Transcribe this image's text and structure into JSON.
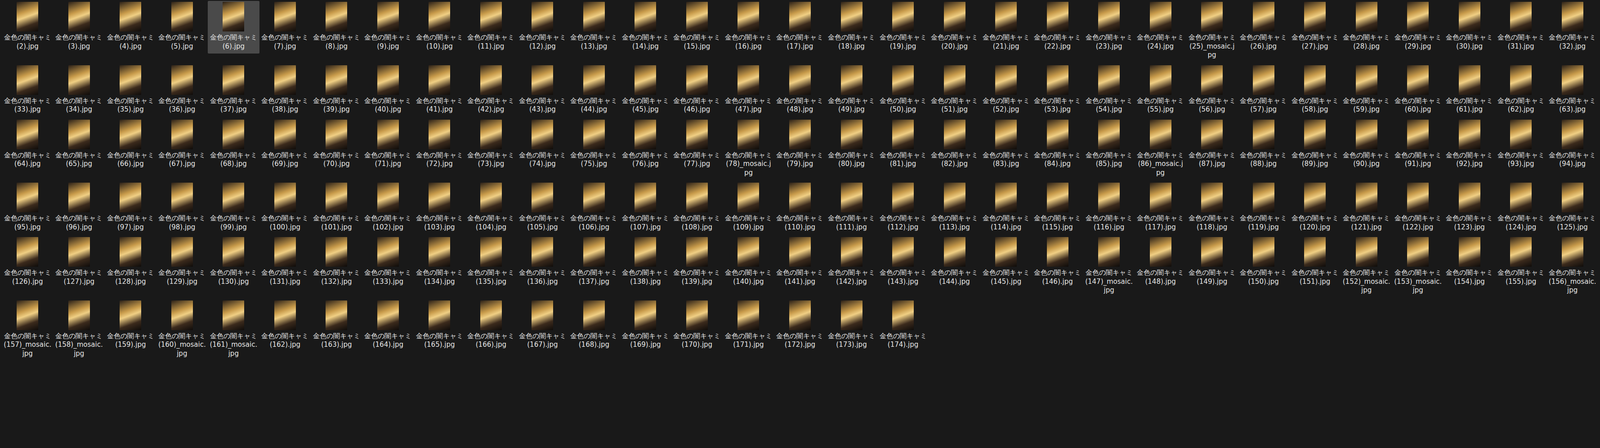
{
  "items": [
    {
      "label": "金色の闇キャミ (2).jpg",
      "selected": false
    },
    {
      "label": "金色の闇キャミ (3).jpg",
      "selected": false
    },
    {
      "label": "金色の闇キャミ (4).jpg",
      "selected": false
    },
    {
      "label": "金色の闇キャミ (5).jpg",
      "selected": false
    },
    {
      "label": "金色の闇キャミ (6).jpg",
      "selected": true
    },
    {
      "label": "金色の闇キャミ (7).jpg",
      "selected": false
    },
    {
      "label": "金色の闇キャミ (8).jpg",
      "selected": false
    },
    {
      "label": "金色の闇キャミ (9).jpg",
      "selected": false
    },
    {
      "label": "金色の闇キャミ (10).jpg",
      "selected": false
    },
    {
      "label": "金色の闇キャミ (11).jpg",
      "selected": false
    },
    {
      "label": "金色の闇キャミ (12).jpg",
      "selected": false
    },
    {
      "label": "金色の闇キャミ (13).jpg",
      "selected": false
    },
    {
      "label": "金色の闇キャミ (14).jpg",
      "selected": false
    },
    {
      "label": "金色の闇キャミ (15).jpg",
      "selected": false
    },
    {
      "label": "金色の闇キャミ (16).jpg",
      "selected": false
    },
    {
      "label": "金色の闇キャミ (17).jpg",
      "selected": false
    },
    {
      "label": "金色の闇キャミ (18).jpg",
      "selected": false
    },
    {
      "label": "金色の闇キャミ (19).jpg",
      "selected": false
    },
    {
      "label": "金色の闇キャミ (20).jpg",
      "selected": false
    },
    {
      "label": "金色の闇キャミ (21).jpg",
      "selected": false
    },
    {
      "label": "金色の闇キャミ (22).jpg",
      "selected": false
    },
    {
      "label": "金色の闇キャミ (23).jpg",
      "selected": false
    },
    {
      "label": "金色の闇キャミ (24).jpg",
      "selected": false
    },
    {
      "label": "金色の闇キャミ (25)_mosaic.jpg",
      "selected": false
    },
    {
      "label": "金色の闇キャミ (26).jpg",
      "selected": false
    },
    {
      "label": "金色の闇キャミ (27).jpg",
      "selected": false
    },
    {
      "label": "金色の闇キャミ (28).jpg",
      "selected": false
    },
    {
      "label": "金色の闇キャミ (29).jpg",
      "selected": false
    },
    {
      "label": "金色の闇キャミ (30).jpg",
      "selected": false
    },
    {
      "label": "金色の闇キャミ (31).jpg",
      "selected": false
    },
    {
      "label": "金色の闇キャミ (32).jpg",
      "selected": false
    },
    {
      "label": "金色の闇キャミ (33).jpg",
      "selected": false
    },
    {
      "label": "金色の闇キャミ (34).jpg",
      "selected": false
    },
    {
      "label": "金色の闇キャミ (35).jpg",
      "selected": false
    },
    {
      "label": "金色の闇キャミ (36).jpg",
      "selected": false
    },
    {
      "label": "金色の闇キャミ (37).jpg",
      "selected": false
    },
    {
      "label": "金色の闇キャミ (38).jpg",
      "selected": false
    },
    {
      "label": "金色の闇キャミ (39).jpg",
      "selected": false
    },
    {
      "label": "金色の闇キャミ (40).jpg",
      "selected": false
    },
    {
      "label": "金色の闇キャミ (41).jpg",
      "selected": false
    },
    {
      "label": "金色の闇キャミ (42).jpg",
      "selected": false
    },
    {
      "label": "金色の闇キャミ (43).jpg",
      "selected": false
    },
    {
      "label": "金色の闇キャミ (44).jpg",
      "selected": false
    },
    {
      "label": "金色の闇キャミ (45).jpg",
      "selected": false
    },
    {
      "label": "金色の闇キャミ (46).jpg",
      "selected": false
    },
    {
      "label": "金色の闇キャミ (47).jpg",
      "selected": false
    },
    {
      "label": "金色の闇キャミ (48).jpg",
      "selected": false
    },
    {
      "label": "金色の闇キャミ (49).jpg",
      "selected": false
    },
    {
      "label": "金色の闇キャミ (50).jpg",
      "selected": false
    },
    {
      "label": "金色の闇キャミ (51).jpg",
      "selected": false
    },
    {
      "label": "金色の闇キャミ (52).jpg",
      "selected": false
    },
    {
      "label": "金色の闇キャミ (53).jpg",
      "selected": false
    },
    {
      "label": "金色の闇キャミ (54).jpg",
      "selected": false
    },
    {
      "label": "金色の闇キャミ (55).jpg",
      "selected": false
    },
    {
      "label": "金色の闇キャミ (56).jpg",
      "selected": false
    },
    {
      "label": "金色の闇キャミ (57).jpg",
      "selected": false
    },
    {
      "label": "金色の闇キャミ (58).jpg",
      "selected": false
    },
    {
      "label": "金色の闇キャミ (59).jpg",
      "selected": false
    },
    {
      "label": "金色の闇キャミ (60).jpg",
      "selected": false
    },
    {
      "label": "金色の闇キャミ (61).jpg",
      "selected": false
    },
    {
      "label": "金色の闇キャミ (62).jpg",
      "selected": false
    },
    {
      "label": "金色の闇キャミ (63).jpg",
      "selected": false
    },
    {
      "label": "金色の闇キャミ (64).jpg",
      "selected": false
    },
    {
      "label": "金色の闇キャミ (65).jpg",
      "selected": false
    },
    {
      "label": "金色の闇キャミ (66).jpg",
      "selected": false
    },
    {
      "label": "金色の闇キャミ (67).jpg",
      "selected": false
    },
    {
      "label": "金色の闇キャミ (68).jpg",
      "selected": false
    },
    {
      "label": "金色の闇キャミ (69).jpg",
      "selected": false
    },
    {
      "label": "金色の闇キャミ (70).jpg",
      "selected": false
    },
    {
      "label": "金色の闇キャミ (71).jpg",
      "selected": false
    },
    {
      "label": "金色の闇キャミ (72).jpg",
      "selected": false
    },
    {
      "label": "金色の闇キャミ (73).jpg",
      "selected": false
    },
    {
      "label": "金色の闇キャミ (74).jpg",
      "selected": false
    },
    {
      "label": "金色の闇キャミ (75).jpg",
      "selected": false
    },
    {
      "label": "金色の闇キャミ (76).jpg",
      "selected": false
    },
    {
      "label": "金色の闇キャミ (77).jpg",
      "selected": false
    },
    {
      "label": "金色の闇キャミ (78)_mosaic.jpg",
      "selected": false
    },
    {
      "label": "金色の闇キャミ (79).jpg",
      "selected": false
    },
    {
      "label": "金色の闇キャミ (80).jpg",
      "selected": false
    },
    {
      "label": "金色の闇キャミ (81).jpg",
      "selected": false
    },
    {
      "label": "金色の闇キャミ (82).jpg",
      "selected": false
    },
    {
      "label": "金色の闇キャミ (83).jpg",
      "selected": false
    },
    {
      "label": "金色の闇キャミ (84).jpg",
      "selected": false
    },
    {
      "label": "金色の闇キャミ (85).jpg",
      "selected": false
    },
    {
      "label": "金色の闇キャミ (86)_mosaic.jpg",
      "selected": false
    },
    {
      "label": "金色の闇キャミ (87).jpg",
      "selected": false
    },
    {
      "label": "金色の闇キャミ (88).jpg",
      "selected": false
    },
    {
      "label": "金色の闇キャミ (89).jpg",
      "selected": false
    },
    {
      "label": "金色の闇キャミ (90).jpg",
      "selected": false
    },
    {
      "label": "金色の闇キャミ (91).jpg",
      "selected": false
    },
    {
      "label": "金色の闇キャミ (92).jpg",
      "selected": false
    },
    {
      "label": "金色の闇キャミ (93).jpg",
      "selected": false
    },
    {
      "label": "金色の闇キャミ (94).jpg",
      "selected": false
    },
    {
      "label": "金色の闇キャミ (95).jpg",
      "selected": false
    },
    {
      "label": "金色の闇キャミ (96).jpg",
      "selected": false
    },
    {
      "label": "金色の闇キャミ (97).jpg",
      "selected": false
    },
    {
      "label": "金色の闇キャミ (98).jpg",
      "selected": false
    },
    {
      "label": "金色の闇キャミ (99).jpg",
      "selected": false
    },
    {
      "label": "金色の闇キャミ (100).jpg",
      "selected": false
    },
    {
      "label": "金色の闇キャミ (101).jpg",
      "selected": false
    },
    {
      "label": "金色の闇キャミ (102).jpg",
      "selected": false
    },
    {
      "label": "金色の闇キャミ (103).jpg",
      "selected": false
    },
    {
      "label": "金色の闇キャミ (104).jpg",
      "selected": false
    },
    {
      "label": "金色の闇キャミ (105).jpg",
      "selected": false
    },
    {
      "label": "金色の闇キャミ (106).jpg",
      "selected": false
    },
    {
      "label": "金色の闇キャミ (107).jpg",
      "selected": false
    },
    {
      "label": "金色の闇キャミ (108).jpg",
      "selected": false
    },
    {
      "label": "金色の闇キャミ (109).jpg",
      "selected": false
    },
    {
      "label": "金色の闇キャミ (110).jpg",
      "selected": false
    },
    {
      "label": "金色の闇キャミ (111).jpg",
      "selected": false
    },
    {
      "label": "金色の闇キャミ (112).jpg",
      "selected": false
    },
    {
      "label": "金色の闇キャミ (113).jpg",
      "selected": false
    },
    {
      "label": "金色の闇キャミ (114).jpg",
      "selected": false
    },
    {
      "label": "金色の闇キャミ (115).jpg",
      "selected": false
    },
    {
      "label": "金色の闇キャミ (116).jpg",
      "selected": false
    },
    {
      "label": "金色の闇キャミ (117).jpg",
      "selected": false
    },
    {
      "label": "金色の闇キャミ (118).jpg",
      "selected": false
    },
    {
      "label": "金色の闇キャミ (119).jpg",
      "selected": false
    },
    {
      "label": "金色の闇キャミ (120).jpg",
      "selected": false
    },
    {
      "label": "金色の闇キャミ (121).jpg",
      "selected": false
    },
    {
      "label": "金色の闇キャミ (122).jpg",
      "selected": false
    },
    {
      "label": "金色の闇キャミ (123).jpg",
      "selected": false
    },
    {
      "label": "金色の闇キャミ (124).jpg",
      "selected": false
    },
    {
      "label": "金色の闇キャミ (125).jpg",
      "selected": false
    },
    {
      "label": "金色の闇キャミ (126).jpg",
      "selected": false
    },
    {
      "label": "金色の闇キャミ (127).jpg",
      "selected": false
    },
    {
      "label": "金色の闇キャミ (128).jpg",
      "selected": false
    },
    {
      "label": "金色の闇キャミ (129).jpg",
      "selected": false
    },
    {
      "label": "金色の闇キャミ (130).jpg",
      "selected": false
    },
    {
      "label": "金色の闇キャミ (131).jpg",
      "selected": false
    },
    {
      "label": "金色の闇キャミ (132).jpg",
      "selected": false
    },
    {
      "label": "金色の闇キャミ (133).jpg",
      "selected": false
    },
    {
      "label": "金色の闇キャミ (134).jpg",
      "selected": false
    },
    {
      "label": "金色の闇キャミ (135).jpg",
      "selected": false
    },
    {
      "label": "金色の闇キャミ (136).jpg",
      "selected": false
    },
    {
      "label": "金色の闇キャミ (137).jpg",
      "selected": false
    },
    {
      "label": "金色の闇キャミ (138).jpg",
      "selected": false
    },
    {
      "label": "金色の闇キャミ (139).jpg",
      "selected": false
    },
    {
      "label": "金色の闇キャミ (140).jpg",
      "selected": false
    },
    {
      "label": "金色の闇キャミ (141).jpg",
      "selected": false
    },
    {
      "label": "金色の闇キャミ (142).jpg",
      "selected": false
    },
    {
      "label": "金色の闇キャミ (143).jpg",
      "selected": false
    },
    {
      "label": "金色の闇キャミ (144).jpg",
      "selected": false
    },
    {
      "label": "金色の闇キャミ (145).jpg",
      "selected": false
    },
    {
      "label": "金色の闇キャミ (146).jpg",
      "selected": false
    },
    {
      "label": "金色の闇キャミ (147)_mosaic.jpg",
      "selected": false
    },
    {
      "label": "金色の闇キャミ (148).jpg",
      "selected": false
    },
    {
      "label": "金色の闇キャミ (149).jpg",
      "selected": false
    },
    {
      "label": "金色の闇キャミ (150).jpg",
      "selected": false
    },
    {
      "label": "金色の闇キャミ (151).jpg",
      "selected": false
    },
    {
      "label": "金色の闇キャミ (152)_mosaic.jpg",
      "selected": false
    },
    {
      "label": "金色の闇キャミ (153)_mosaic.jpg",
      "selected": false
    },
    {
      "label": "金色の闇キャミ (154).jpg",
      "selected": false
    },
    {
      "label": "金色の闇キャミ (155).jpg",
      "selected": false
    },
    {
      "label": "金色の闇キャミ (156)_mosaic.jpg",
      "selected": false
    },
    {
      "label": "金色の闇キャミ (157)_mosaic.jpg",
      "selected": false
    },
    {
      "label": "金色の闇キャミ (158)_mosaic.jpg",
      "selected": false
    },
    {
      "label": "金色の闇キャミ (159).jpg",
      "selected": false
    },
    {
      "label": "金色の闇キャミ (160)_mosaic.jpg",
      "selected": false
    },
    {
      "label": "金色の闇キャミ (161)_mosaic.jpg",
      "selected": false
    },
    {
      "label": "金色の闇キャミ (162).jpg",
      "selected": false
    },
    {
      "label": "金色の闇キャミ (163).jpg",
      "selected": false
    },
    {
      "label": "金色の闇キャミ (164).jpg",
      "selected": false
    },
    {
      "label": "金色の闇キャミ (165).jpg",
      "selected": false
    },
    {
      "label": "金色の闇キャミ (166).jpg",
      "selected": false
    },
    {
      "label": "金色の闇キャミ (167).jpg",
      "selected": false
    },
    {
      "label": "金色の闇キャミ (168).jpg",
      "selected": false
    },
    {
      "label": "金色の闇キャミ (169).jpg",
      "selected": false
    },
    {
      "label": "金色の闇キャミ (170).jpg",
      "selected": false
    },
    {
      "label": "金色の闇キャミ (171).jpg",
      "selected": false
    },
    {
      "label": "金色の闇キャミ (172).jpg",
      "selected": false
    },
    {
      "label": "金色の闇キャミ (173).jpg",
      "selected": false
    },
    {
      "label": "金色の闇キャミ (174).jpg",
      "selected": false
    }
  ]
}
